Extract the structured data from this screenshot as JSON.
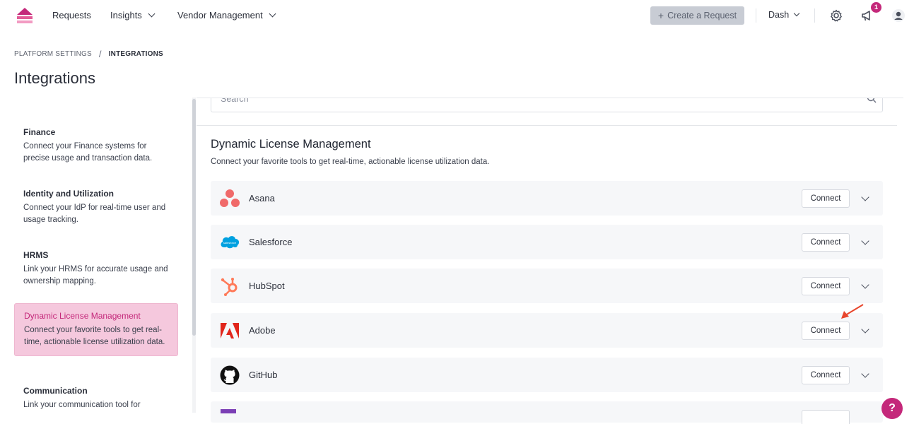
{
  "nav": {
    "items": [
      {
        "label": "Requests",
        "dropdown": false
      },
      {
        "label": "Insights",
        "dropdown": true
      },
      {
        "label": "Vendor Management",
        "dropdown": true
      }
    ],
    "create_button": "Create a Request",
    "create_icon": "plus-icon",
    "workspace": "Dash",
    "notification_count": "1",
    "icons": [
      "logo-icon",
      "gear-icon",
      "megaphone-icon",
      "user-icon"
    ]
  },
  "breadcrumb": {
    "parent": "PLATFORM SETTINGS",
    "separator": "/",
    "current": "INTEGRATIONS"
  },
  "page": {
    "title": "Integrations"
  },
  "sidebar": {
    "items": [
      {
        "title": "Finance",
        "desc": "Connect your Finance systems for precise usage and transaction data.",
        "active": false
      },
      {
        "title": "Identity and Utilization",
        "desc": "Connect your IdP for real-time user and usage tracking.",
        "active": false
      },
      {
        "title": "HRMS",
        "desc": "Link your HRMS for accurate usage and ownership mapping.",
        "active": false
      },
      {
        "title": "Dynamic License Management",
        "desc": "Connect your favorite tools to get real-time, actionable license utilization data.",
        "active": true
      },
      {
        "title": "Communication",
        "desc": "Link your communication tool for",
        "active": false
      }
    ]
  },
  "search": {
    "placeholder": "Search"
  },
  "section": {
    "title": "Dynamic License Management",
    "description": "Connect your favorite tools to get real-time, actionable license utilization data."
  },
  "integrations": [
    {
      "name": "Asana",
      "icon": "asana-icon",
      "button": "Connect"
    },
    {
      "name": "Salesforce",
      "icon": "salesforce-icon",
      "button": "Connect"
    },
    {
      "name": "HubSpot",
      "icon": "hubspot-icon",
      "button": "Connect"
    },
    {
      "name": "Adobe",
      "icon": "adobe-icon",
      "button": "Connect"
    },
    {
      "name": "GitHub",
      "icon": "github-icon",
      "button": "Connect"
    }
  ],
  "help_label": "?",
  "colors": {
    "accent": "#c4287a",
    "active_bg": "#f5c8dd",
    "asana": "#f06a6a",
    "salesforce": "#00a1e0",
    "hubspot": "#ff7a59",
    "adobe": "#e1251b",
    "github": "#000000",
    "annotation_arrow": "#e8452c"
  }
}
